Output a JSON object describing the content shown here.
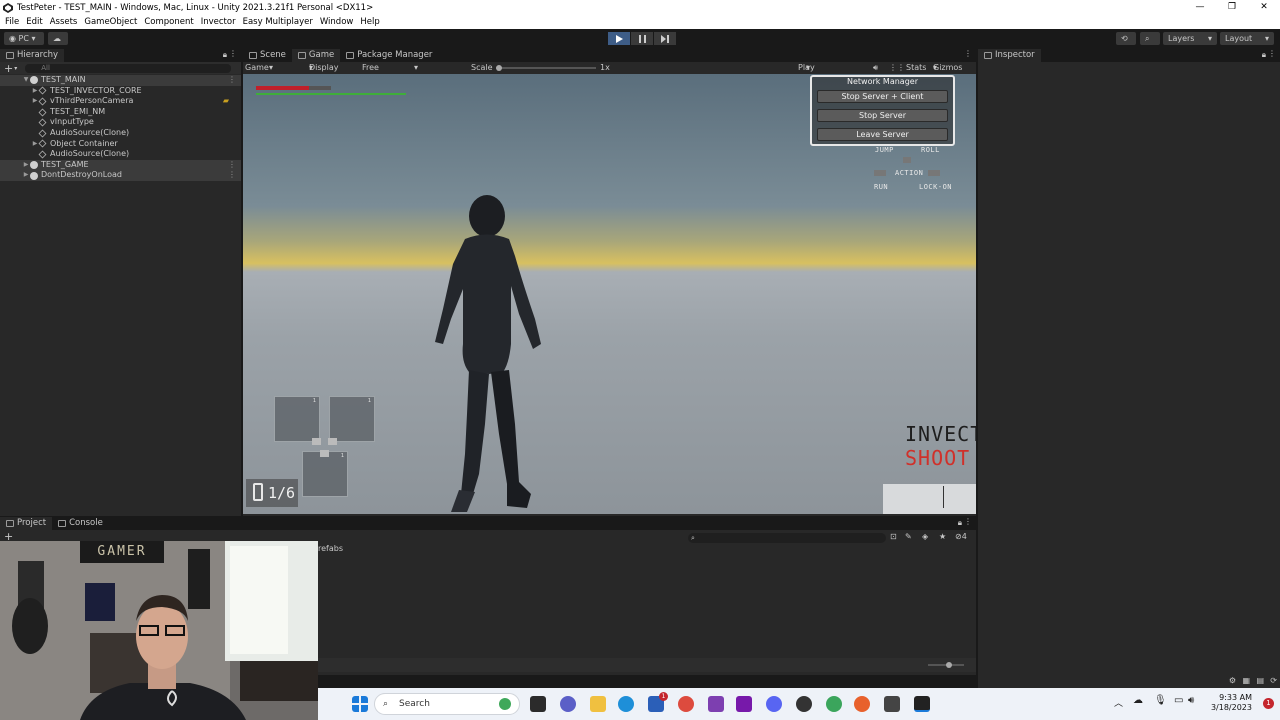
{
  "window": {
    "title": "TestPeter - TEST_MAIN - Windows, Mac, Linux - Unity 2021.3.21f1 Personal <DX11>",
    "controls": [
      "—",
      "❐",
      "✕"
    ]
  },
  "menu": [
    "File",
    "Edit",
    "Assets",
    "GameObject",
    "Component",
    "Invector",
    "Easy Multiplayer",
    "Window",
    "Help"
  ],
  "toolbar": {
    "platform": "PC",
    "layers": "Layers",
    "layout": "Layout"
  },
  "hierarchy": {
    "tab": "Hierarchy",
    "search_placeholder": "All",
    "rows": [
      {
        "label": "TEST_MAIN",
        "type": "scene"
      },
      {
        "label": "TEST_INVECTOR_CORE",
        "type": "object"
      },
      {
        "label": "vThirdPersonCamera",
        "type": "object"
      },
      {
        "label": "TEST_EMI_NM",
        "type": "object"
      },
      {
        "label": "vInputType",
        "type": "object"
      },
      {
        "label": "AudioSource(Clone)",
        "type": "object"
      },
      {
        "label": "Object Container",
        "type": "object"
      },
      {
        "label": "AudioSource(Clone)",
        "type": "object"
      },
      {
        "label": "TEST_GAME",
        "type": "scene"
      },
      {
        "label": "DontDestroyOnLoad",
        "type": "scene"
      }
    ]
  },
  "center_tabs": [
    "Scene",
    "Game",
    "Package Manager"
  ],
  "game_toolbar": {
    "mode": "Game",
    "display": "Display 1",
    "aspect": "Free Aspect",
    "scale_label": "Scale",
    "scale_value": "1x",
    "play_focused": "Play Focused",
    "stats": "Stats",
    "gizmos": "Gizmos"
  },
  "network_manager": {
    "title": "Network Manager",
    "buttons": [
      "Stop Server + Client",
      "Stop Server",
      "Leave Server"
    ]
  },
  "hud": {
    "hints": [
      "JUMP",
      "ROLL",
      "ACTION",
      "RUN",
      "LOCK-ON"
    ],
    "ammo": "1/6",
    "logo_line1": "INVECT",
    "logo_line2": "SHOOT",
    "slot_numbers": [
      "1",
      "1",
      "1"
    ],
    "health_fraction": 0.7,
    "stamina_fraction": 1.0
  },
  "inspector": {
    "tab": "Inspector"
  },
  "project": {
    "tabs": [
      "Project",
      "Console"
    ],
    "folder_label": "refabs",
    "filter_count": "4"
  },
  "webcam": {
    "poster_text": "GAMER"
  },
  "taskbar": {
    "search": "Search",
    "time": "9:33 AM",
    "date": "3/18/2023",
    "notification_badge": "1",
    "store_badge": "1"
  }
}
